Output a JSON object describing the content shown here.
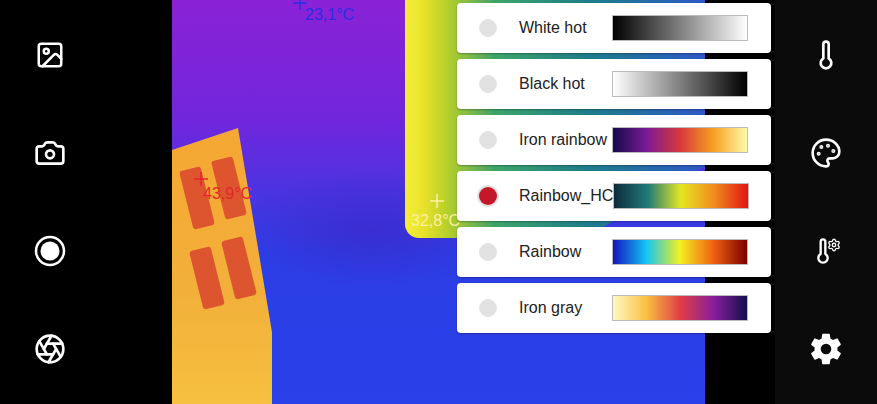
{
  "markers": [
    {
      "label": "23,1°C",
      "color": "#2a2ee0"
    },
    {
      "label": "43,9°C",
      "color": "#e3262c"
    },
    {
      "label": "32,8°C",
      "color": "#fff0a0"
    }
  ],
  "palette_menu": {
    "items": [
      {
        "label": "White hot",
        "selected": false,
        "colors": [
          "#000000",
          "#ffffff"
        ]
      },
      {
        "label": "Black hot",
        "selected": false,
        "colors": [
          "#ffffff",
          "#000000"
        ]
      },
      {
        "label": "Iron rainbow",
        "selected": false,
        "colors": [
          "#140a4a",
          "#7a1a96",
          "#d8383c",
          "#f6a024",
          "#fffaa8"
        ]
      },
      {
        "label": "Rainbow_HC",
        "selected": true,
        "colors": [
          "#0e2a3a",
          "#1f7a7a",
          "#e6e622",
          "#f08a1e",
          "#e01414"
        ]
      },
      {
        "label": "Rainbow",
        "selected": false,
        "colors": [
          "#1414c0",
          "#14c6f4",
          "#f4f01e",
          "#f06012",
          "#7a0000"
        ]
      },
      {
        "label": "Iron gray",
        "selected": false,
        "colors": [
          "#fff8c4",
          "#f8c040",
          "#e03e44",
          "#8a1e9e",
          "#12104c"
        ]
      }
    ]
  }
}
